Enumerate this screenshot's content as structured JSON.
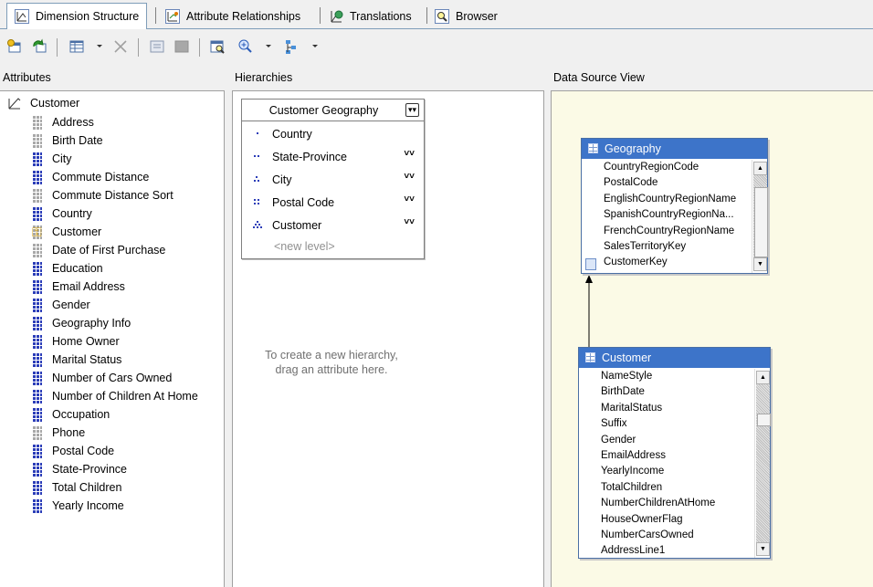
{
  "tabs": [
    {
      "label": "Dimension Structure",
      "icon": "dimension-structure-icon",
      "active": true
    },
    {
      "label": "Attribute Relationships",
      "icon": "attribute-relationships-icon",
      "active": false
    },
    {
      "label": "Translations",
      "icon": "translations-icon",
      "active": false
    },
    {
      "label": "Browser",
      "icon": "browser-icon",
      "active": false
    }
  ],
  "toolbar": {
    "icons": [
      "add-table-icon",
      "refresh-icon",
      "show-grid-icon",
      "delete-icon",
      "diagram-icon",
      "stop-icon",
      "show-table-icon",
      "zoom-icon",
      "arrange-icon"
    ]
  },
  "panes": {
    "attributes": "Attributes",
    "hierarchies": "Hierarchies",
    "dsv": "Data Source View"
  },
  "attributes": {
    "root": "Customer",
    "items": [
      {
        "label": "Address",
        "icon": "gray"
      },
      {
        "label": "Birth Date",
        "icon": "gray"
      },
      {
        "label": "City",
        "icon": "blue"
      },
      {
        "label": "Commute Distance",
        "icon": "blue"
      },
      {
        "label": "Commute Distance Sort",
        "icon": "gray"
      },
      {
        "label": "Country",
        "icon": "blue"
      },
      {
        "label": "Customer",
        "icon": "key"
      },
      {
        "label": "Date of First Purchase",
        "icon": "gray"
      },
      {
        "label": "Education",
        "icon": "blue"
      },
      {
        "label": "Email Address",
        "icon": "blue"
      },
      {
        "label": "Gender",
        "icon": "blue"
      },
      {
        "label": "Geography Info",
        "icon": "blue"
      },
      {
        "label": "Home Owner",
        "icon": "blue"
      },
      {
        "label": "Marital Status",
        "icon": "blue"
      },
      {
        "label": "Number of Cars Owned",
        "icon": "blue"
      },
      {
        "label": "Number of Children At Home",
        "icon": "blue"
      },
      {
        "label": "Occupation",
        "icon": "blue"
      },
      {
        "label": "Phone",
        "icon": "gray"
      },
      {
        "label": "Postal Code",
        "icon": "blue"
      },
      {
        "label": "State-Province",
        "icon": "blue"
      },
      {
        "label": "Total Children",
        "icon": "blue"
      },
      {
        "label": "Yearly Income",
        "icon": "blue"
      }
    ]
  },
  "hierarchy": {
    "title": "Customer Geography",
    "levels": [
      {
        "label": "Country",
        "depth": 1,
        "expandable": false
      },
      {
        "label": "State-Province",
        "depth": 2,
        "expandable": true
      },
      {
        "label": "City",
        "depth": 3,
        "expandable": true
      },
      {
        "label": "Postal Code",
        "depth": 4,
        "expandable": true
      },
      {
        "label": "Customer",
        "depth": 5,
        "expandable": true
      }
    ],
    "new_level": "<new level>",
    "hint_line1": "To create a new hierarchy,",
    "hint_line2": "drag an attribute here."
  },
  "dsv": {
    "geography": {
      "title": "Geography",
      "columns": [
        "CountryRegionCode",
        "PostalCode",
        "EnglishCountryRegionName",
        "SpanishCountryRegionNa...",
        "FrenchCountryRegionName",
        "SalesTerritoryKey",
        "CustomerKey"
      ],
      "scroll": {
        "position": 1.0,
        "visible_fraction": 0.85
      }
    },
    "customer": {
      "title": "Customer",
      "columns": [
        "NameStyle",
        "BirthDate",
        "MaritalStatus",
        "Suffix",
        "Gender",
        "EmailAddress",
        "YearlyIncome",
        "TotalChildren",
        "NumberChildrenAtHome",
        "HouseOwnerFlag",
        "NumberCarsOwned",
        "AddressLine1"
      ],
      "scroll": {
        "position": 0.2,
        "visible_fraction": 0.08
      }
    }
  },
  "colors": {
    "table_header": "#3d74c9",
    "dsv_background": "#fbfae6",
    "attribute_icon": "#2b3db8",
    "attribute_icon_inactive": "#a8a8a8"
  }
}
